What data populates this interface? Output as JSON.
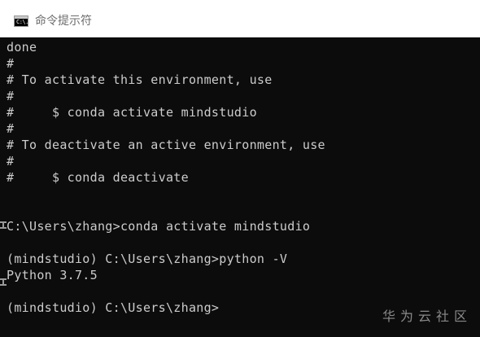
{
  "window": {
    "title": "命令提示符",
    "icon": "console-app-icon",
    "icon_glyph": "C:\\."
  },
  "console": {
    "lines": [
      "done",
      "#",
      "# To activate this environment, use",
      "#",
      "#     $ conda activate mindstudio",
      "#",
      "# To deactivate an active environment, use",
      "#",
      "#     $ conda deactivate",
      "",
      "",
      "C:\\Users\\zhang>conda activate mindstudio",
      "",
      "(mindstudio) C:\\Users\\zhang>python -V",
      "Python 3.7.5",
      "",
      "(mindstudio) C:\\Users\\zhang>"
    ],
    "text_color": "#cccccc",
    "background": "#0c0c0c"
  },
  "watermark": {
    "text": "华为云社区"
  }
}
